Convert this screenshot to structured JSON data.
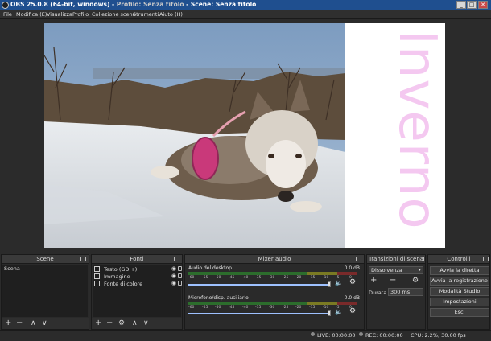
{
  "window": {
    "title_left": "OBS 25.0.8 (64-bit, windows) - ",
    "title_profile": "Profilo: Senza titolo",
    "title_right": " - Scene: Senza titolo",
    "minimize": "_",
    "maximize": "□",
    "close": "✕"
  },
  "menu": [
    "File",
    "Modifica (E)",
    "Visualizza",
    "Profilo",
    "Collezione scene",
    "Strumenti",
    "Aiuto (H)"
  ],
  "preview": {
    "overlay_text": "Inverno",
    "overlay_color": "#f4c8f0"
  },
  "scenes": {
    "title": "Scene",
    "items": [
      "Scena"
    ],
    "tools": [
      "+",
      "−",
      "∧",
      "∨"
    ]
  },
  "sources": {
    "title": "Fonti",
    "items": [
      {
        "label": "Testo (GDI+)"
      },
      {
        "label": "Immagine"
      },
      {
        "label": "Fonte di colore"
      }
    ],
    "tools": [
      "+",
      "−",
      "⚙",
      "∧",
      "∨"
    ]
  },
  "mixer": {
    "title": "Mixer audio",
    "tick_labels": [
      "-60",
      "-55",
      "-50",
      "-45",
      "-40",
      "-35",
      "-30",
      "-25",
      "-20",
      "-15",
      "-10",
      "-5",
      "0"
    ],
    "channels": [
      {
        "name": "Audio del desktop",
        "db": "0.0 dB"
      },
      {
        "name": "Microfono/disp. ausiliario",
        "db": "0.0 dB"
      }
    ]
  },
  "transitions": {
    "title": "Transizioni di scena",
    "selected": "Dissolvenza",
    "duration_label": "Durata",
    "duration_value": "300 ms",
    "tools": [
      "+",
      "−",
      "⚙"
    ]
  },
  "controls": {
    "title": "Controlli",
    "buttons": [
      "Avvia la diretta",
      "Avvia la registrazione",
      "Modalità Studio",
      "Impostazioni",
      "Esci"
    ]
  },
  "status": {
    "live": "LIVE: 00:00:00",
    "rec": "REC: 00:00:00",
    "cpu": "CPU: 2.2%, 30.00 fps"
  }
}
